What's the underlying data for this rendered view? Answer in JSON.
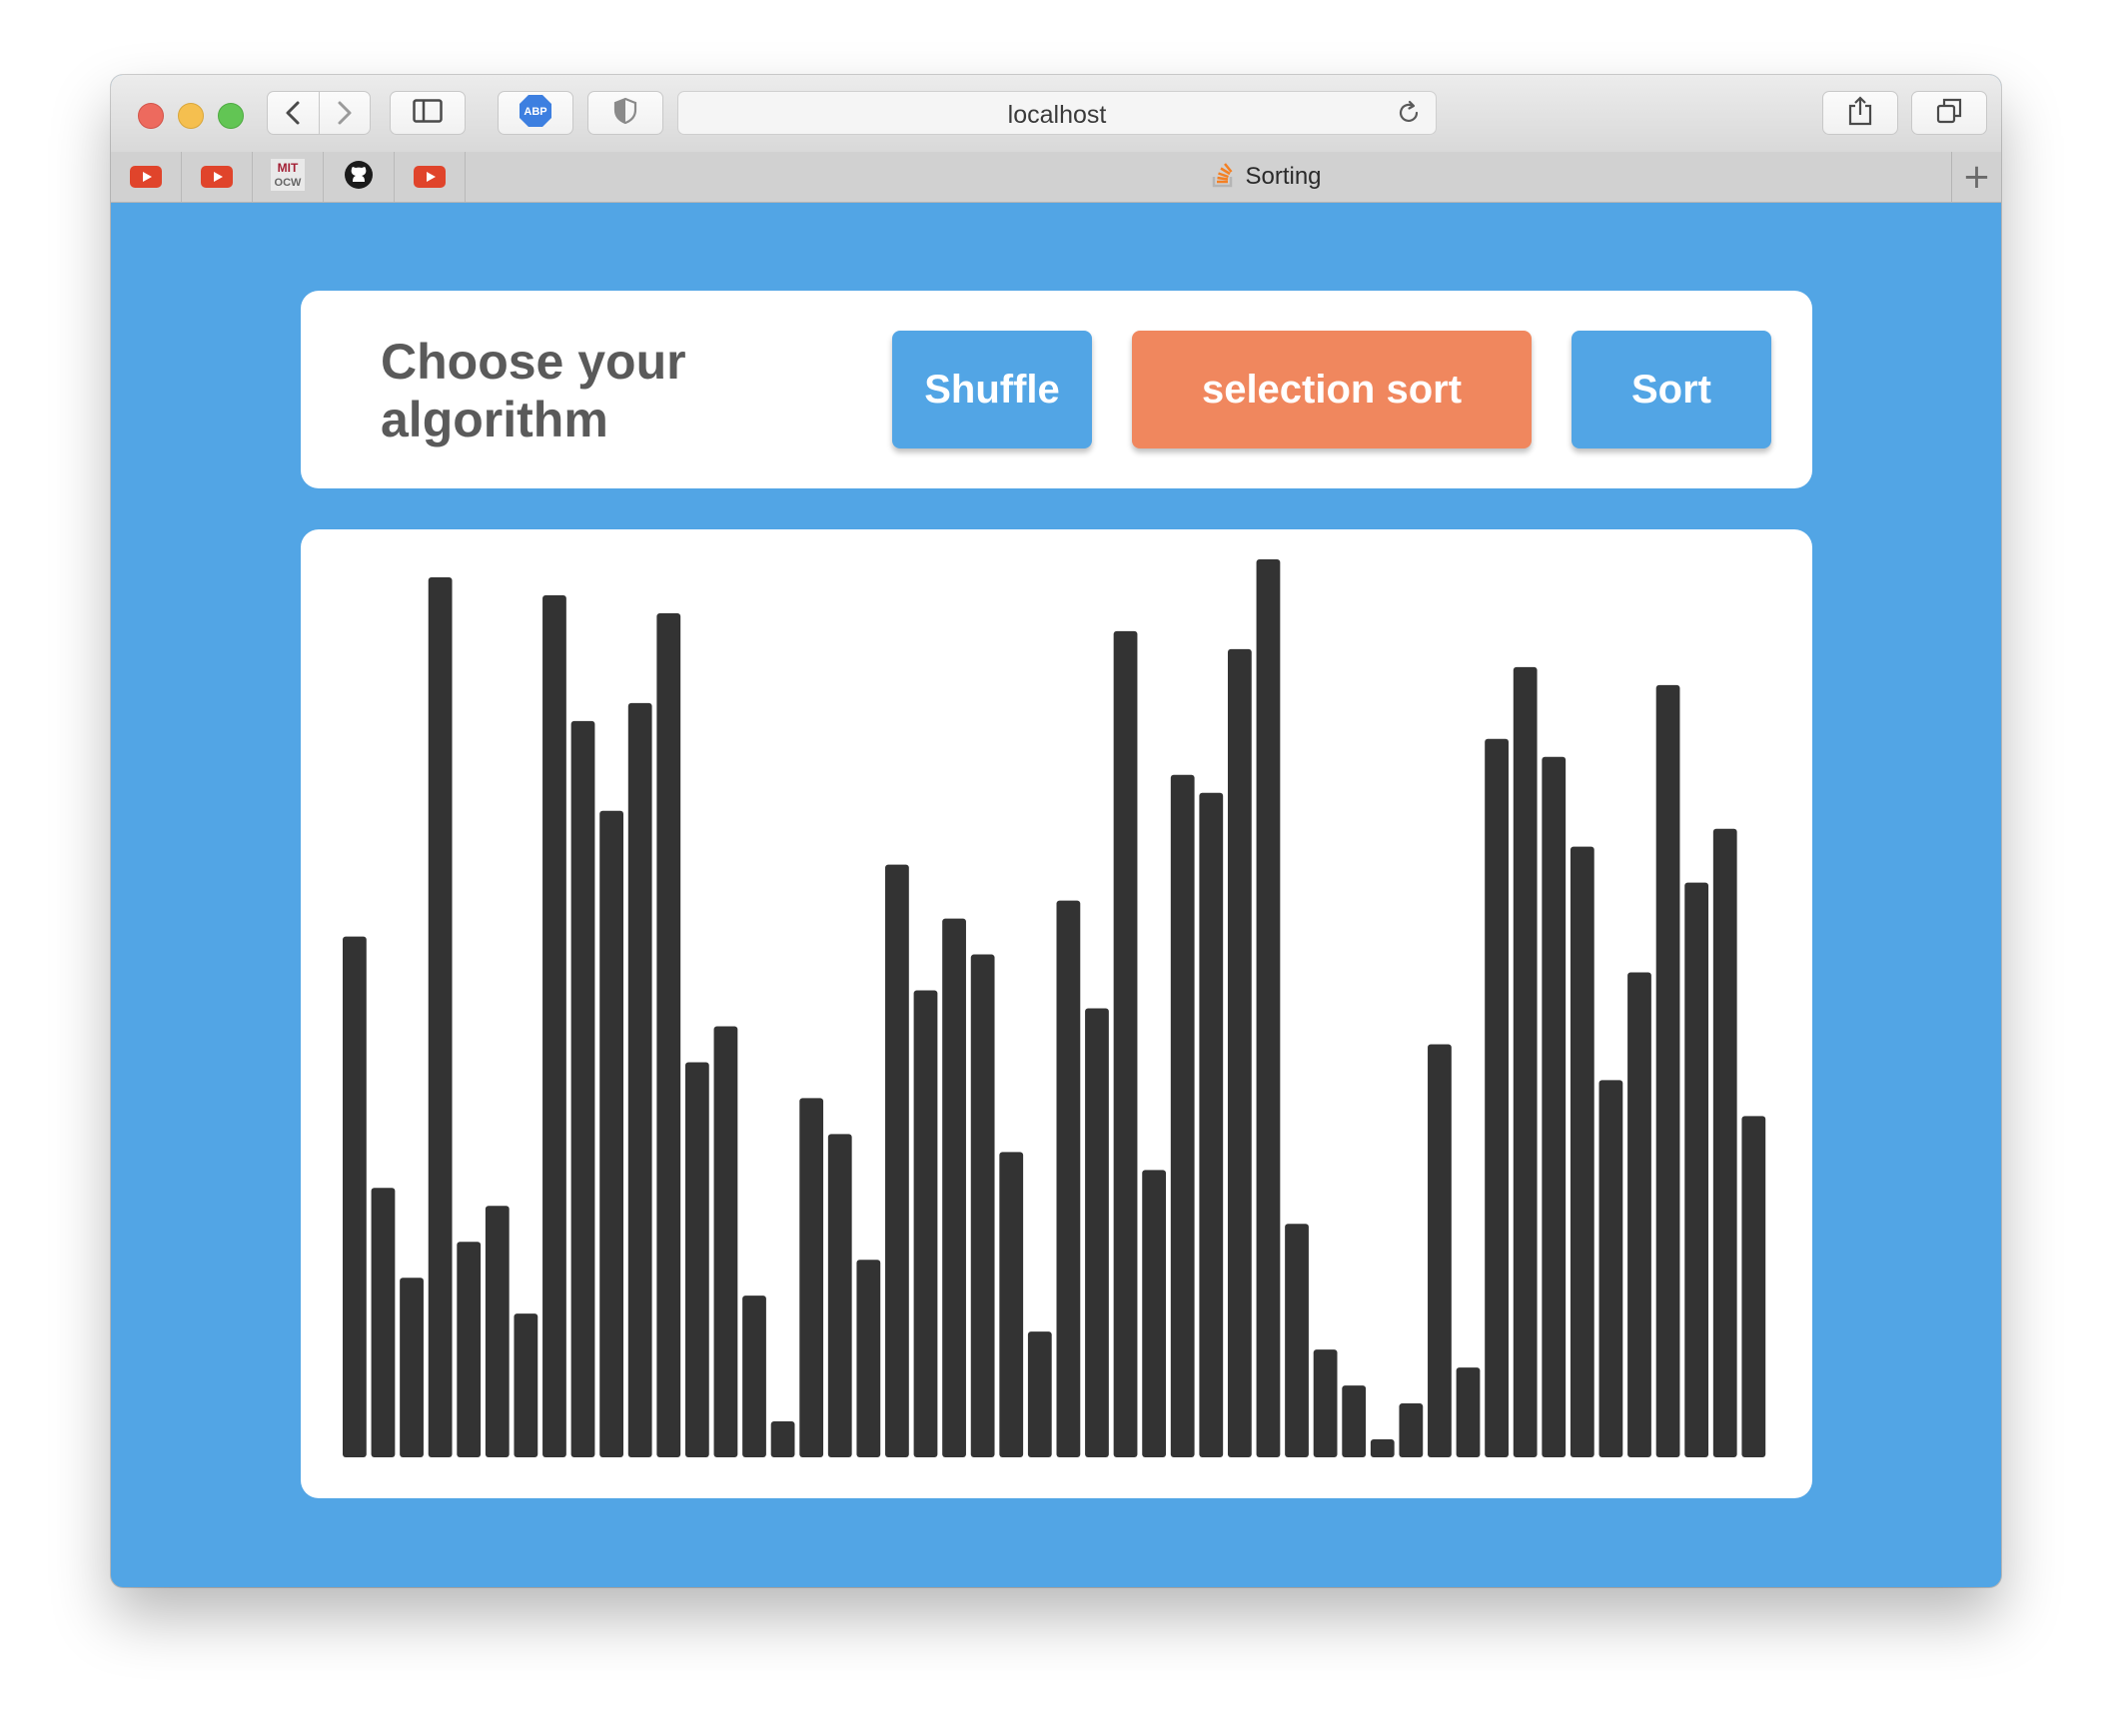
{
  "browser": {
    "url": "localhost",
    "tab_title": "Sorting",
    "favorites": [
      "youtube-icon",
      "youtube-icon",
      "mit-ocw-icon",
      "github-icon",
      "youtube-icon"
    ],
    "mit_label_top": "MIT",
    "mit_label_bottom": "OCW",
    "abp_label": "ABP",
    "new_tab_label": "+"
  },
  "controls": {
    "heading": "Choose your algorithm",
    "shuffle_label": "Shuffle",
    "algorithm_label": "selection sort",
    "sort_label": "Sort"
  },
  "colors": {
    "page_bg": "#52a5e5",
    "button_blue": "#52a5e5",
    "button_orange": "#f0875e",
    "bar": "#333333"
  },
  "chart_data": {
    "type": "bar",
    "values": [
      58,
      30,
      20,
      98,
      24,
      28,
      16,
      96,
      82,
      72,
      84,
      94,
      44,
      48,
      18,
      4,
      40,
      36,
      22,
      66,
      52,
      60,
      56,
      34,
      14,
      62,
      50,
      92,
      32,
      76,
      74,
      90,
      100,
      26,
      12,
      8,
      2,
      6,
      46,
      10,
      80,
      88,
      78,
      68,
      42,
      54,
      86,
      64,
      70,
      38
    ],
    "ylim": [
      0,
      100
    ]
  }
}
